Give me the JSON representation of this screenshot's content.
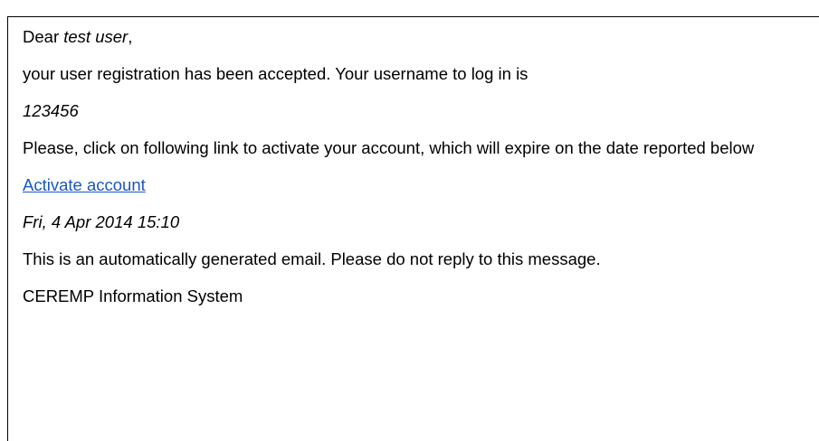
{
  "email": {
    "greeting_prefix": "Dear ",
    "user_name": "test user",
    "greeting_suffix": ",",
    "registration_text": "your user registration has been accepted. Your username to log in is",
    "username": "123456",
    "activation_instructions": "Please, click on following link to activate your account, which will expire on the date reported below",
    "activation_link_label": "Activate account",
    "expiry_date": "Fri, 4 Apr 2014 15:10",
    "auto_generated_notice": "This is an automatically generated email. Please do not reply to this message.",
    "signature": "CEREMP Information System"
  },
  "colors": {
    "link": "#1a57c4",
    "text": "#000000",
    "border": "#000000"
  }
}
